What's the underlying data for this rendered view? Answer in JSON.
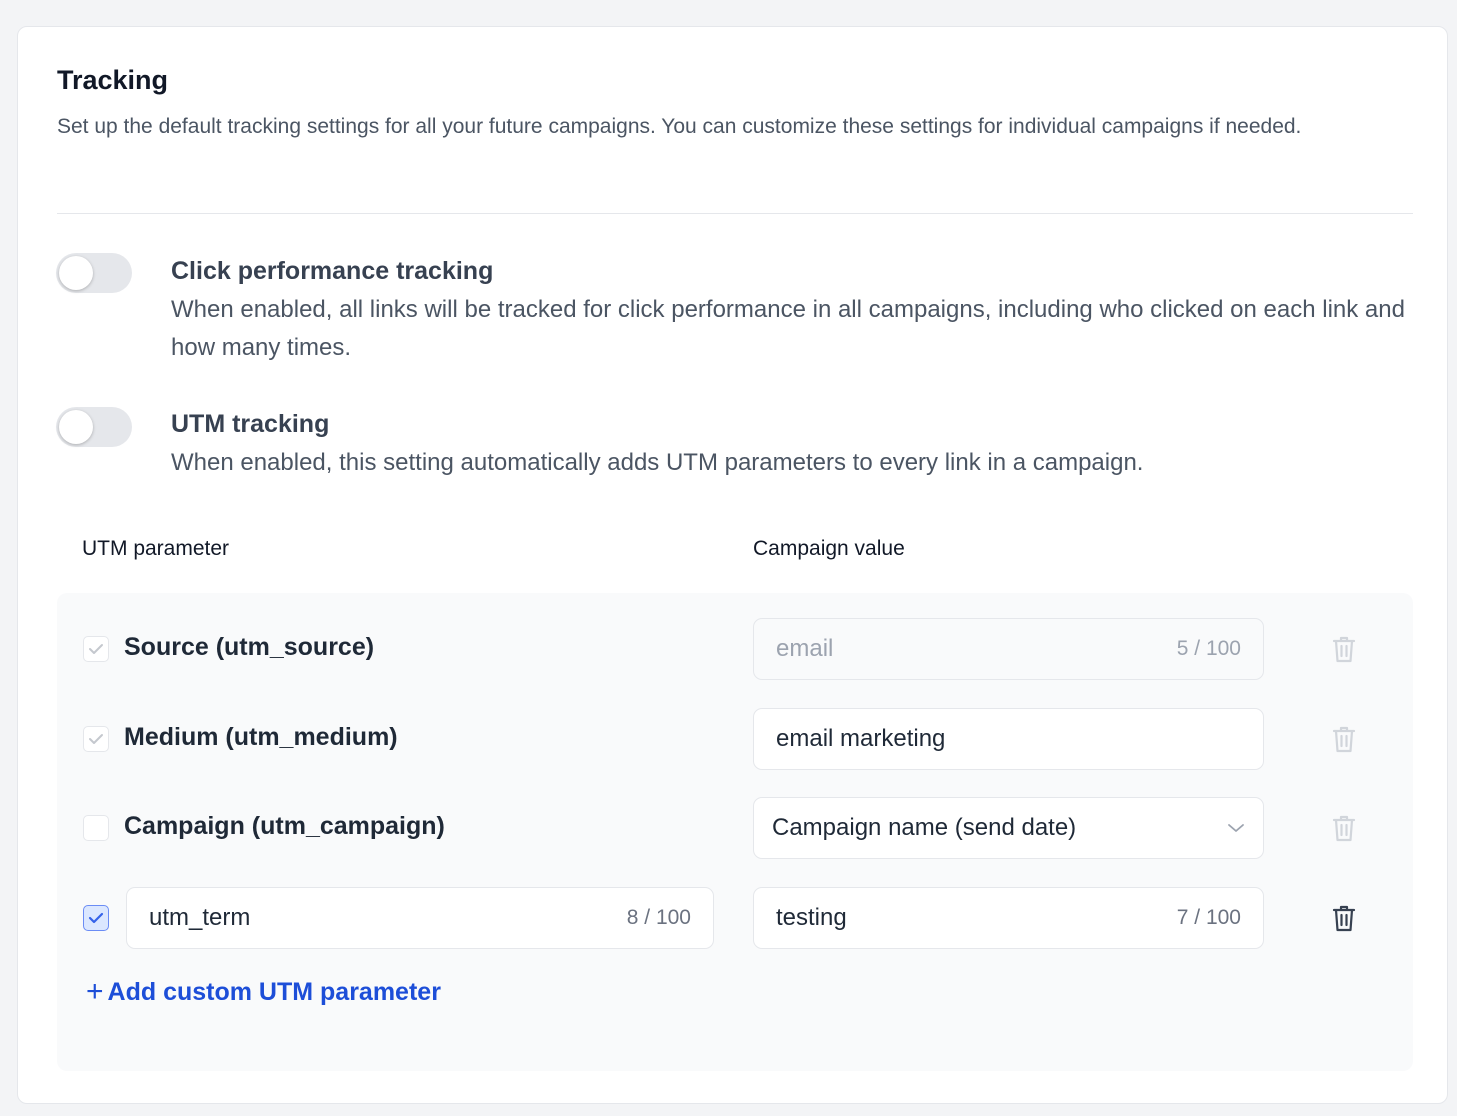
{
  "section": {
    "title": "Tracking",
    "description": "Set up the default tracking settings for all your future campaigns. You can customize these settings for individual campaigns if needed."
  },
  "options": [
    {
      "title": "Click performance tracking",
      "description": "When enabled, all links will be tracked for click performance in all campaigns, including who clicked on each link and how many times.",
      "enabled": false
    },
    {
      "title": "UTM tracking",
      "description": "When enabled, this setting automatically adds UTM parameters to every link in a campaign.",
      "enabled": false
    }
  ],
  "utm_table": {
    "col_parameter": "UTM parameter",
    "col_value": "Campaign value",
    "rows": [
      {
        "label": "Source (utm_source)",
        "value": "email",
        "counter": "5 / 100",
        "checked": true,
        "disabled": true
      },
      {
        "label": "Medium (utm_medium)",
        "value": "email marketing",
        "checked": true,
        "disabled": true
      },
      {
        "label": "Campaign (utm_campaign)",
        "value": "Campaign name (send date)",
        "checked": false,
        "type": "select"
      },
      {
        "label": "utm_term",
        "label_counter": "8 / 100",
        "value": "testing",
        "counter": "7 / 100",
        "checked": true,
        "custom": true
      }
    ],
    "add_label": "Add custom UTM parameter"
  },
  "colors": {
    "accent": "#1d4ed8",
    "checkbox_checked_bg": "#dbe7ff",
    "toggle_off": "#e5e7eb"
  }
}
